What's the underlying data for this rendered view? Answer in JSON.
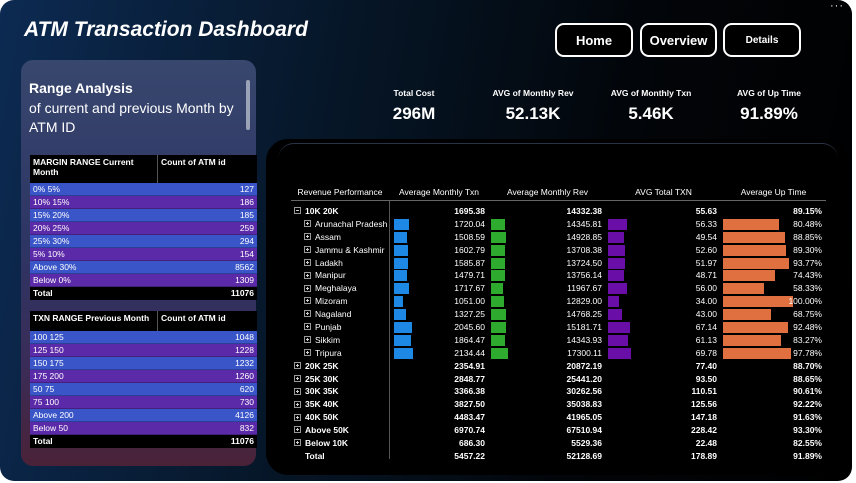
{
  "title": "ATM Transaction Dashboard",
  "more_menu": "···",
  "nav": {
    "home": "Home",
    "overview": "Overview",
    "details": "Details"
  },
  "kpis": [
    {
      "label": "Total Cost",
      "value": "296M"
    },
    {
      "label": "AVG of Monthly Rev",
      "value": "52.13K"
    },
    {
      "label": "AVG of Monthly Txn",
      "value": "5.46K"
    },
    {
      "label": "AVG of Up Time",
      "value": "91.89%"
    }
  ],
  "range_analysis": {
    "title": "Range Analysis",
    "subtitle": "of current and previous Month by ATM ID",
    "margin_table": {
      "headers": [
        "MARGIN RANGE Current Month",
        "Count of ATM id"
      ],
      "rows": [
        [
          "0% 5%",
          "127"
        ],
        [
          "10% 15%",
          "186"
        ],
        [
          "15% 20%",
          "185"
        ],
        [
          "20% 25%",
          "259"
        ],
        [
          "25% 30%",
          "294"
        ],
        [
          "5% 10%",
          "154"
        ],
        [
          "Above 30%",
          "8562"
        ],
        [
          "Below 0%",
          "1309"
        ]
      ],
      "total": [
        "Total",
        "11076"
      ]
    },
    "txn_table": {
      "headers": [
        "TXN RANGE Previous Month",
        "Count of ATM id"
      ],
      "rows": [
        [
          "100 125",
          "1048"
        ],
        [
          "125 150",
          "1228"
        ],
        [
          "150 175",
          "1232"
        ],
        [
          "175 200",
          "1260"
        ],
        [
          "50 75",
          "620"
        ],
        [
          "75 100",
          "730"
        ],
        [
          "Above 200",
          "4126"
        ],
        [
          "Below 50",
          "832"
        ]
      ],
      "total": [
        "Total",
        "11076"
      ]
    }
  },
  "matrix": {
    "headers": [
      "Revenue Performance",
      "Average Monthly Txn",
      "Average Monthly Rev",
      "AVG Total TXN",
      "Average Up Time"
    ],
    "colors": {
      "txn": "#1e88e5",
      "rev": "#2eaa2e",
      "tot": "#6a0ea8",
      "up": "#e07040"
    },
    "rows": [
      {
        "level": 0,
        "toggle": "minus",
        "name": "10K 20K",
        "txn": "1695.38",
        "rev": "14332.38",
        "tot": "55.63",
        "up": "89.15%"
      },
      {
        "level": 1,
        "toggle": "plus",
        "name": "Arunachal Pradesh",
        "txn": "1720.04",
        "rev": "14345.81",
        "tot": "56.33",
        "up": "80.48%",
        "b": [
          1720.04,
          14345.81,
          56.33,
          80.48
        ]
      },
      {
        "level": 1,
        "toggle": "plus",
        "name": "Assam",
        "txn": "1508.59",
        "rev": "14928.85",
        "tot": "49.54",
        "up": "88.85%",
        "b": [
          1508.59,
          14928.85,
          49.54,
          88.85
        ]
      },
      {
        "level": 1,
        "toggle": "plus",
        "name": "Jammu & Kashmir",
        "txn": "1602.79",
        "rev": "13708.38",
        "tot": "52.60",
        "up": "89.30%",
        "b": [
          1602.79,
          13708.38,
          52.6,
          89.3
        ]
      },
      {
        "level": 1,
        "toggle": "plus",
        "name": "Ladakh",
        "txn": "1585.87",
        "rev": "13724.50",
        "tot": "51.97",
        "up": "93.77%",
        "b": [
          1585.87,
          13724.5,
          51.97,
          93.77
        ]
      },
      {
        "level": 1,
        "toggle": "plus",
        "name": "Manipur",
        "txn": "1479.71",
        "rev": "13756.14",
        "tot": "48.71",
        "up": "74.43%",
        "b": [
          1479.71,
          13756.14,
          48.71,
          74.43
        ]
      },
      {
        "level": 1,
        "toggle": "plus",
        "name": "Meghalaya",
        "txn": "1717.67",
        "rev": "11967.67",
        "tot": "56.00",
        "up": "58.33%",
        "b": [
          1717.67,
          11967.67,
          56.0,
          58.33
        ]
      },
      {
        "level": 1,
        "toggle": "plus",
        "name": "Mizoram",
        "txn": "1051.00",
        "rev": "12829.00",
        "tot": "34.00",
        "up": "100.00%",
        "b": [
          1051.0,
          12829.0,
          34.0,
          100.0
        ]
      },
      {
        "level": 1,
        "toggle": "plus",
        "name": "Nagaland",
        "txn": "1327.25",
        "rev": "14768.25",
        "tot": "43.00",
        "up": "68.75%",
        "b": [
          1327.25,
          14768.25,
          43.0,
          68.75
        ]
      },
      {
        "level": 1,
        "toggle": "plus",
        "name": "Punjab",
        "txn": "2045.60",
        "rev": "15181.71",
        "tot": "67.14",
        "up": "92.48%",
        "b": [
          2045.6,
          15181.71,
          67.14,
          92.48
        ]
      },
      {
        "level": 1,
        "toggle": "plus",
        "name": "Sikkim",
        "txn": "1864.47",
        "rev": "14343.93",
        "tot": "61.13",
        "up": "83.27%",
        "b": [
          1864.47,
          14343.93,
          61.13,
          83.27
        ]
      },
      {
        "level": 1,
        "toggle": "plus",
        "name": "Tripura",
        "txn": "2134.44",
        "rev": "17300.11",
        "tot": "69.78",
        "up": "97.78%",
        "b": [
          2134.44,
          17300.11,
          69.78,
          97.78
        ]
      },
      {
        "level": 0,
        "toggle": "plus",
        "name": "20K 25K",
        "txn": "2354.91",
        "rev": "20872.19",
        "tot": "77.40",
        "up": "88.70%"
      },
      {
        "level": 0,
        "toggle": "plus",
        "name": "25K 30K",
        "txn": "2848.77",
        "rev": "25441.20",
        "tot": "93.50",
        "up": "88.65%"
      },
      {
        "level": 0,
        "toggle": "plus",
        "name": "30K 35K",
        "txn": "3366.38",
        "rev": "30262.56",
        "tot": "110.51",
        "up": "90.61%"
      },
      {
        "level": 0,
        "toggle": "plus",
        "name": "35K 40K",
        "txn": "3827.50",
        "rev": "35038.83",
        "tot": "125.56",
        "up": "92.22%"
      },
      {
        "level": 0,
        "toggle": "plus",
        "name": "40K 50K",
        "txn": "4483.47",
        "rev": "41965.05",
        "tot": "147.18",
        "up": "91.63%"
      },
      {
        "level": 0,
        "toggle": "plus",
        "name": "Above 50K",
        "txn": "6970.74",
        "rev": "67510.94",
        "tot": "228.42",
        "up": "93.30%"
      },
      {
        "level": 0,
        "toggle": "plus",
        "name": "Below 10K",
        "txn": "686.30",
        "rev": "5529.36",
        "tot": "22.48",
        "up": "82.55%"
      },
      {
        "level": 0,
        "toggle": "none",
        "name": "Total",
        "txn": "5457.22",
        "rev": "52128.69",
        "tot": "178.89",
        "up": "91.89%"
      }
    ]
  }
}
